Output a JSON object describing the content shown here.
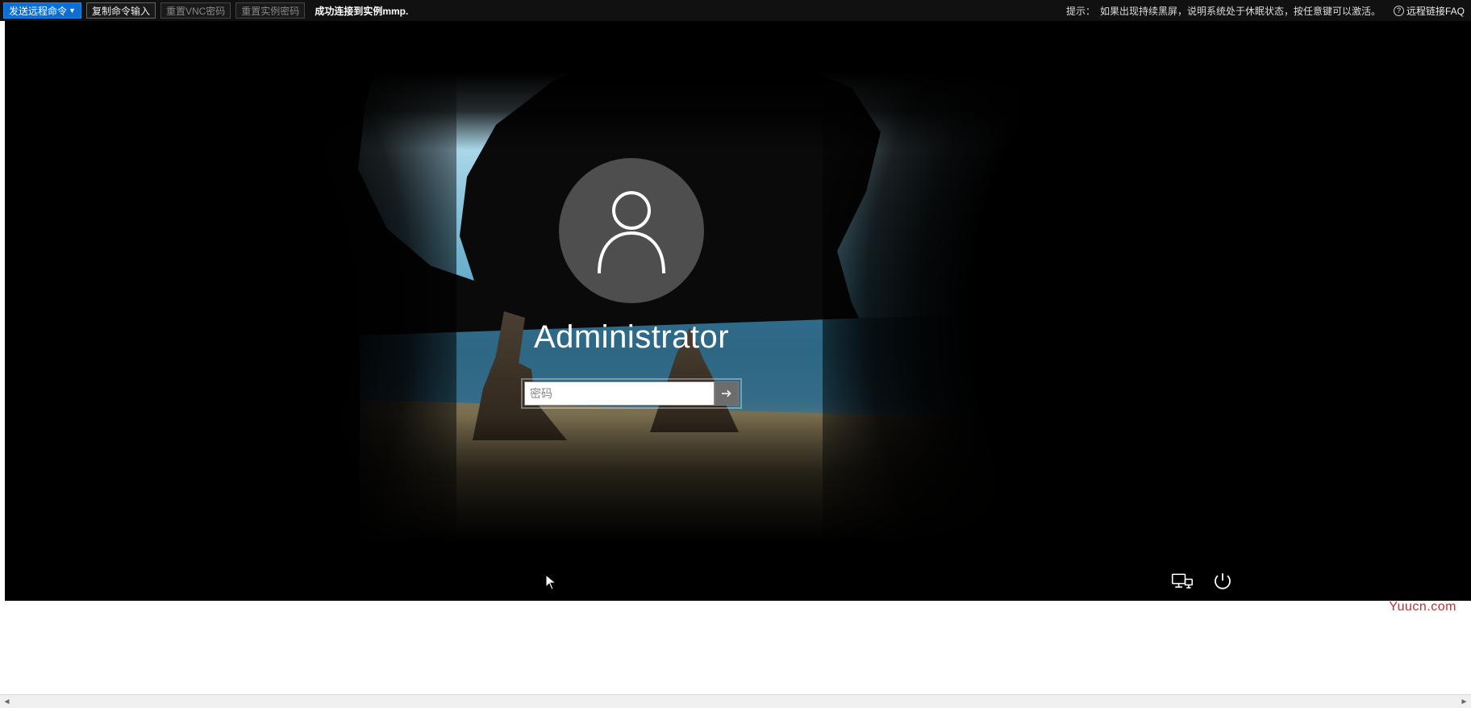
{
  "topbar": {
    "send_remote_cmd": "发送远程命令",
    "copy_cmd_input": "复制命令输入",
    "reset_vnc_pw": "重置VNC密码",
    "reset_instance_pw": "重置实例密码",
    "status": "成功连接到实例mmp.",
    "tip_label": "提示：",
    "tip_text": "如果出现持续黑屏，说明系统处于休眠状态，按任意键可以激活。",
    "faq_label": "远程链接FAQ"
  },
  "login": {
    "username": "Administrator",
    "password_placeholder": "密码",
    "password_value": ""
  },
  "icons": {
    "user_avatar": "user-icon",
    "submit_arrow": "arrow-right-icon",
    "network": "network-icon",
    "power": "power-icon",
    "help": "help-circle-icon",
    "caret": "caret-down-icon",
    "cursor": "cursor-icon"
  },
  "watermark": "Yuucn.com"
}
